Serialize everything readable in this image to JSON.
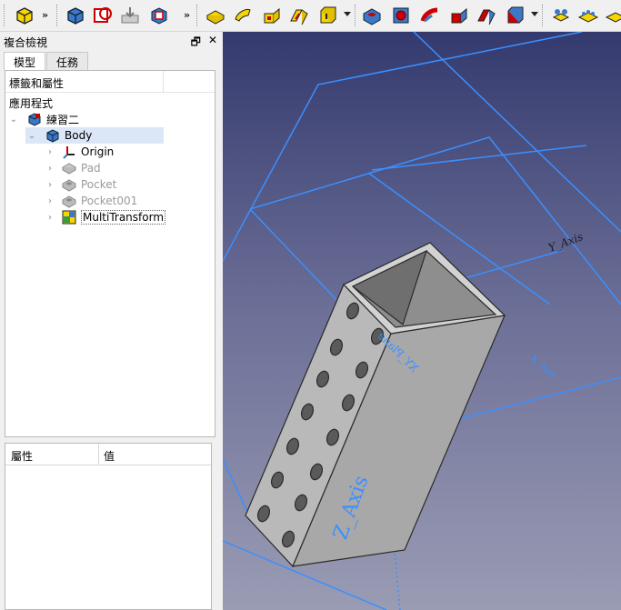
{
  "toolbar": {
    "more_left": "»",
    "more_mid": "»"
  },
  "panel": {
    "title": "複合檢視",
    "float_btn": "🗗",
    "close_btn": "✕",
    "tabs": [
      {
        "label": "模型",
        "active": true
      },
      {
        "label": "任務",
        "active": false
      }
    ],
    "tree_header": "標籤和屬性",
    "tree": {
      "app_label": "應用程式",
      "document": "練習二",
      "body": "Body",
      "children": [
        {
          "label": "Origin",
          "icon": "origin-icon",
          "dim": false
        },
        {
          "label": "Pad",
          "icon": "pad-icon",
          "dim": true
        },
        {
          "label": "Pocket",
          "icon": "pocket-icon",
          "dim": true
        },
        {
          "label": "Pocket001",
          "icon": "pocket-icon",
          "dim": true
        },
        {
          "label": "MultiTransform",
          "icon": "multitransform-icon",
          "dim": false
        }
      ]
    },
    "props": {
      "col_property": "屬性",
      "col_value": "值"
    }
  },
  "viewport": {
    "labels": {
      "z_axis": "Z_Axis",
      "xy_plane": "XY_Plane",
      "y_axis": "Y_Axis",
      "x_axis": "X_Axis"
    },
    "colors": {
      "plane_lines": "#3b8fff",
      "solid": "#b4b4b4",
      "bg_top": "#343a6e",
      "bg_bottom": "#9a9cb4"
    }
  }
}
